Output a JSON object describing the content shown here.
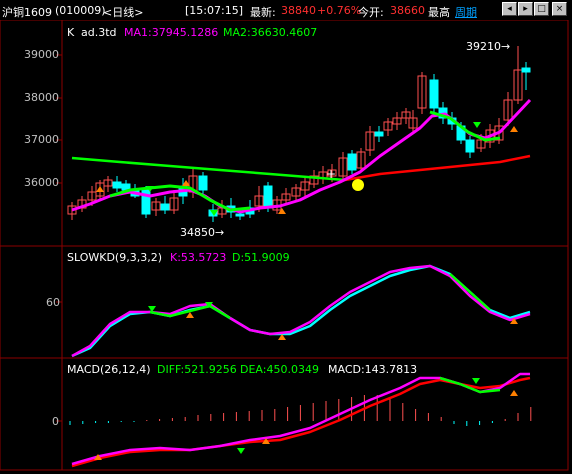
{
  "titlebar": {
    "symbol": "沪铜1609",
    "code": "(010009)",
    "period": "<日线>",
    "time": "[15:07:15]",
    "latest_label": "最新:",
    "latest_value": "38840",
    "change_pct": "+0.76%",
    "open_label": "今开:",
    "open_value": "38660",
    "high_label": "最高",
    "week_link": "周期",
    "buttons": [
      "prev-icon",
      "next-icon",
      "maximize-icon",
      "close-icon"
    ]
  },
  "main_panel": {
    "title_k": "K",
    "indicator_name": "ad.3td",
    "ma1": "MA1:37945.1286",
    "ma2": "MA2:36630.4607",
    "y_ticks": [
      "39000",
      "38000",
      "37000",
      "36000"
    ],
    "annotation_high": "39210",
    "annotation_low": "34850"
  },
  "kd_panel": {
    "title": "SLOWKD(9,3,3,2)",
    "k": "K:53.5723",
    "d": "D:51.9009",
    "y_ticks": [
      "60"
    ]
  },
  "macd_panel": {
    "title": "MACD(26,12,4)",
    "diff": "DIFF:521.9256",
    "dea": "DEA:450.0349",
    "macd": "MACD:143.7813",
    "y_ticks": [
      "0"
    ]
  },
  "colors": {
    "up": "#ff5050",
    "down": "#00ffff",
    "ma1": "#ff00ff",
    "ma2": "#00ff00",
    "ma_long": "#ff0000",
    "grid": "#8b0000",
    "text": "#c0c0c0",
    "yellow": "#ffff00"
  }
}
